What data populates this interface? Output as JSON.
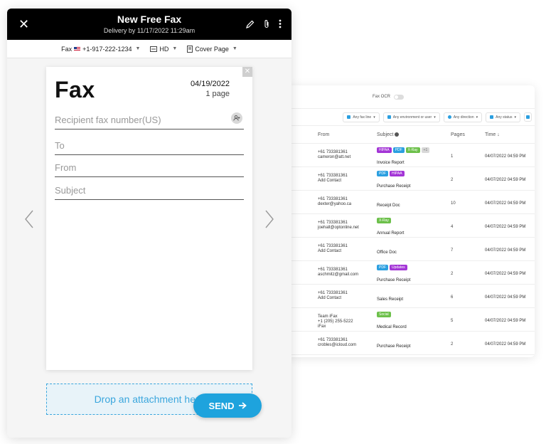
{
  "composer": {
    "title": "New Free Fax",
    "delivery": "Delivery by 11/17/2022 11:29am",
    "toolbar": {
      "number_prefix": "Fax",
      "number": "+1-917-222-1234",
      "quality": "HD",
      "cover": "Cover Page"
    },
    "page": {
      "heading": "Fax",
      "date": "04/19/2022",
      "pages": "1 page",
      "recipient_placeholder": "Recipient fax number(US)",
      "to_placeholder": "To",
      "from_placeholder": "From",
      "subject_placeholder": "Subject"
    },
    "drop_text": "Drop an attachment here",
    "send_label": "SEND"
  },
  "inbox": {
    "ocr_label": "Fax OCR",
    "filters": [
      "Any fax line",
      "Any environment or user",
      "Any direction",
      "Any status"
    ],
    "columns": {
      "from": "From",
      "subject": "Subject",
      "pages": "Pages",
      "time": "Time"
    },
    "rows": [
      {
        "from1": "+61 733381361",
        "from2": "cameron@att.net",
        "subject": "Invoice Report",
        "pages": "1",
        "time": "04/07/2022 04:59 PM",
        "tags": [
          {
            "t": "HIPAA",
            "c": "#a335d6"
          },
          {
            "t": "PDF",
            "c": "#2b9fe0"
          },
          {
            "t": "X-Ray",
            "c": "#6cc04a"
          },
          {
            "t": "+1",
            "c": "#d8d8d8"
          }
        ]
      },
      {
        "from1": "+61 733381361",
        "from2": "Add Contact",
        "subject": "Purchase Receipt",
        "pages": "2",
        "time": "04/07/2022 04:59 PM",
        "tags": [
          {
            "t": "PDF",
            "c": "#2b9fe0"
          },
          {
            "t": "HIPAA",
            "c": "#a335d6"
          }
        ]
      },
      {
        "from1": "+61 733381361",
        "from2": "dexter@yahoo.ca",
        "subject": "Receipt Doc",
        "pages": "10",
        "time": "04/07/2022 04:59 PM",
        "tags": []
      },
      {
        "from1": "+61 733381361",
        "from2": "joehall@optonline.net",
        "subject": "Annual Report",
        "pages": "4",
        "time": "04/07/2022 04:59 PM",
        "tags": [
          {
            "t": "X-Ray",
            "c": "#6cc04a"
          }
        ]
      },
      {
        "from1": "+61 733381361",
        "from2": "Add Contact",
        "subject": "Office Doc",
        "pages": "7",
        "time": "04/07/2022 04:59 PM",
        "tags": []
      },
      {
        "from1": "+61 733381361",
        "from2": "aschmitz@gmail.com",
        "subject": "Purchase Receipt",
        "pages": "2",
        "time": "04/07/2022 04:59 PM",
        "tags": [
          {
            "t": "PDF",
            "c": "#2b9fe0"
          },
          {
            "t": "Updates",
            "c": "#a335d6"
          }
        ]
      },
      {
        "from1": "+61 733381361",
        "from2": "Add Contact",
        "subject": "Sales Receipt",
        "pages": "6",
        "time": "04/07/2022 04:59 PM",
        "tags": []
      },
      {
        "from1": "Team iFax",
        "from2": "+1 (205) 255-5222",
        "from3": "iFax",
        "subject": "Medical Record",
        "pages": "5",
        "time": "04/07/2022 04:59 PM",
        "tags": [
          {
            "t": "Social",
            "c": "#6cc04a"
          }
        ]
      },
      {
        "from1": "+61 733381361",
        "from2": "crobles@icloud.com",
        "subject": "Purchase Receipt",
        "pages": "2",
        "time": "04/07/2022 04:59 PM",
        "tags": []
      }
    ]
  }
}
